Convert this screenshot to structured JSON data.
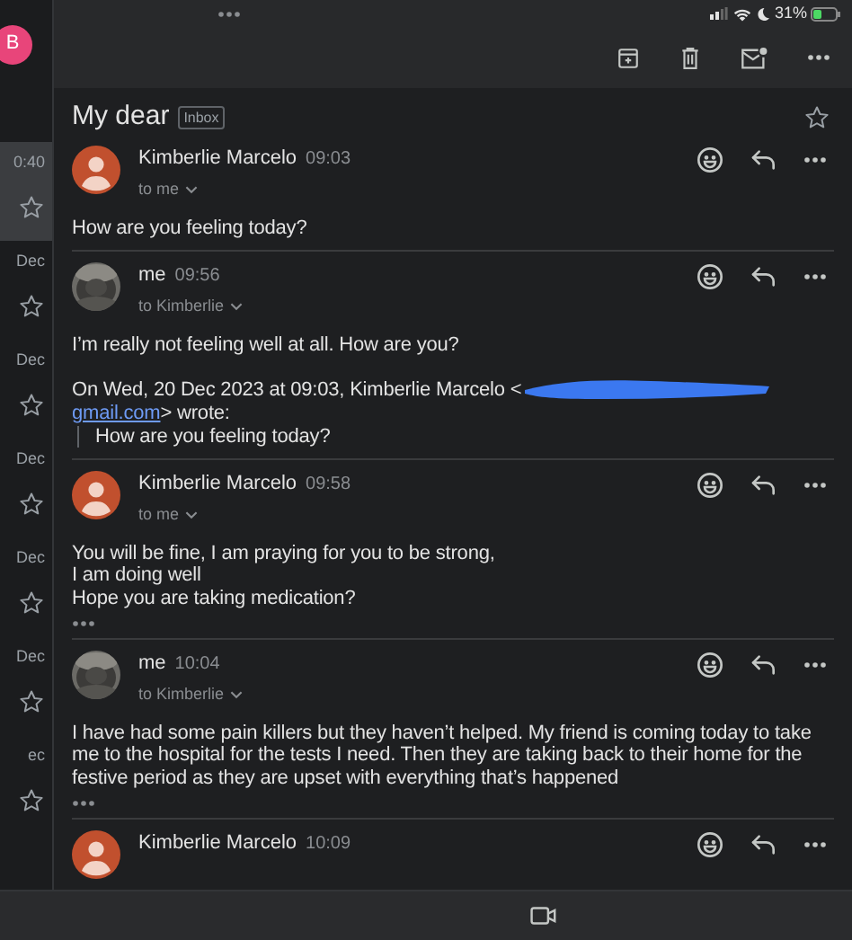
{
  "status_bar": {
    "battery": "31%"
  },
  "sidebar": {
    "account_initial": "B",
    "items": [
      {
        "time": "0:40",
        "selected": true,
        "starred": false
      },
      {
        "time": "Dec",
        "selected": false,
        "starred": false
      },
      {
        "time": "Dec",
        "selected": false,
        "starred": false
      },
      {
        "time": "Dec",
        "selected": false,
        "starred": false
      },
      {
        "time": "Dec",
        "selected": false,
        "starred": false
      },
      {
        "time": "Dec",
        "selected": false,
        "starred": false
      },
      {
        "time": "ec",
        "selected": false,
        "starred": false
      }
    ]
  },
  "thread": {
    "subject": "My dear",
    "label": "Inbox",
    "starred": false
  },
  "messages": [
    {
      "kind": "contact",
      "sender": "Kimberlie Marcelo",
      "time": "09:03",
      "recipient": "to me",
      "body": [
        "How are you feeling today?"
      ],
      "more": false
    },
    {
      "kind": "self",
      "sender": "me",
      "time": "09:56",
      "recipient": "to Kimberlie",
      "body": [
        "I’m really not feeling well at all. How are you?"
      ],
      "quote": {
        "attribution": "On Wed, 20 Dec 2023 at 09:03, Kimberlie Marcelo <",
        "link": "gmail.com",
        "attribution_end": "> wrote:",
        "quoted": "How are you feeling today?"
      },
      "more": false
    },
    {
      "kind": "contact",
      "sender": "Kimberlie Marcelo",
      "time": "09:58",
      "recipient": "to me",
      "body": [
        "You will be fine, I am praying for you to be strong,",
        "I am doing well",
        "Hope you are taking medication?"
      ],
      "more": true
    },
    {
      "kind": "self",
      "sender": "me",
      "time": "10:04",
      "recipient": "to Kimberlie",
      "body": [
        "I have had some pain killers but they haven’t helped. My friend is coming today to take me to the hospital for the tests I need. Then they are taking back to their home for the festive period as they are upset with everything that’s happened"
      ],
      "more": true
    },
    {
      "kind": "contact",
      "sender": "Kimberlie Marcelo",
      "time": "10:09"
    }
  ]
}
